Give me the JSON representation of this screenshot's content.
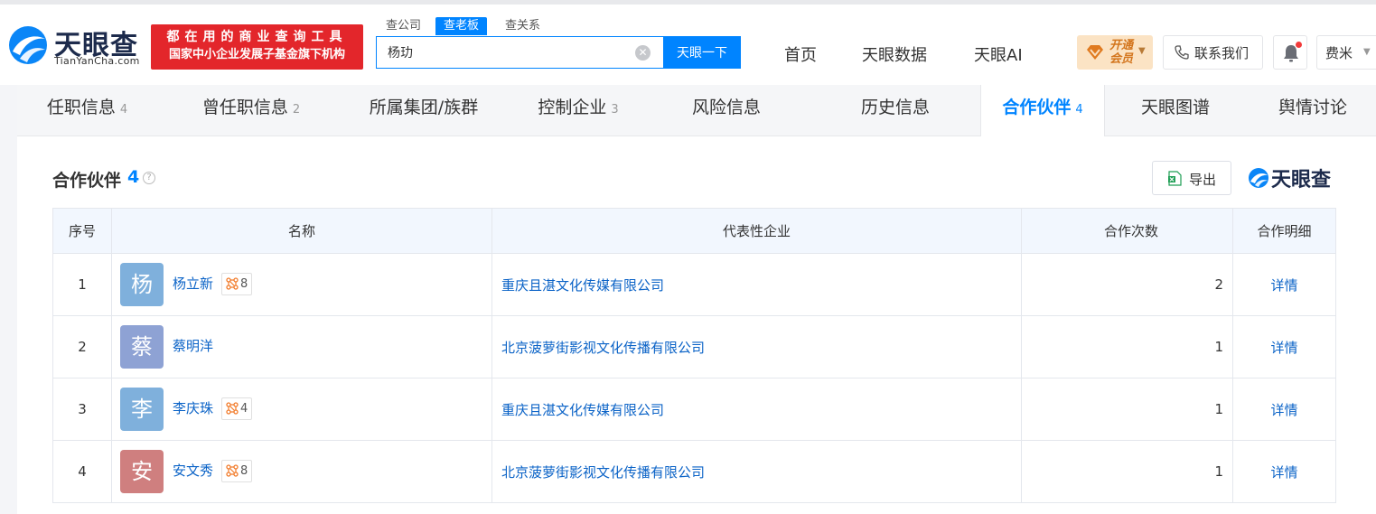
{
  "brand": {
    "name_cn": "天眼查",
    "domain": "TianYanCha.com",
    "promo_line1": "都在用的商业查询工具",
    "promo_line2": "国家中小企业发展子基金旗下机构"
  },
  "search": {
    "tabs": [
      {
        "label": "查公司",
        "active": false
      },
      {
        "label": "查老板",
        "active": true
      },
      {
        "label": "查关系",
        "active": false
      }
    ],
    "value": "杨玏",
    "button": "天眼一下"
  },
  "nav": {
    "items": [
      "首页",
      "天眼数据",
      "天眼AI"
    ],
    "vip_label": "开通会员",
    "contact_label": "联系我们",
    "user_label": "费米"
  },
  "subtabs": [
    {
      "label": "任职信息",
      "count": "4"
    },
    {
      "label": "曾任职信息",
      "count": "2"
    },
    {
      "label": "所属集团/族群",
      "count": ""
    },
    {
      "label": "控制企业",
      "count": "3"
    },
    {
      "label": "风险信息",
      "count": ""
    },
    {
      "label": "历史信息",
      "count": ""
    },
    {
      "label": "合作伙伴",
      "count": "4",
      "active": true
    },
    {
      "label": "天眼图谱",
      "count": ""
    },
    {
      "label": "舆情讨论",
      "count": ""
    }
  ],
  "section": {
    "title": "合作伙伴",
    "count": "4",
    "help": "?",
    "export_label": "导出",
    "brand_label": "天眼查"
  },
  "table": {
    "headers": [
      "序号",
      "名称",
      "代表性企业",
      "合作次数",
      "合作明细"
    ],
    "rows": [
      {
        "index": "1",
        "avatar": "杨",
        "avatar_color": "#7fb0dc",
        "name": "杨立新",
        "rel": "8",
        "company": "重庆且湛文化传媒有限公司",
        "times": "2",
        "detail": "详情"
      },
      {
        "index": "2",
        "avatar": "蔡",
        "avatar_color": "#8ea2d4",
        "name": "蔡明洋",
        "rel": "",
        "company": "北京菠萝街影视文化传播有限公司",
        "times": "1",
        "detail": "详情"
      },
      {
        "index": "3",
        "avatar": "李",
        "avatar_color": "#7fb0dc",
        "name": "李庆珠",
        "rel": "4",
        "company": "重庆且湛文化传媒有限公司",
        "times": "1",
        "detail": "详情"
      },
      {
        "index": "4",
        "avatar": "安",
        "avatar_color": "#cf7f7f",
        "name": "安文秀",
        "rel": "8",
        "company": "北京菠萝街影视文化传播有限公司",
        "times": "1",
        "detail": "详情"
      }
    ]
  },
  "colors": {
    "accent": "#0084ff",
    "link": "#0b63c7",
    "promo_red": "#e3262b",
    "vip_bg": "#fbe3c4"
  }
}
